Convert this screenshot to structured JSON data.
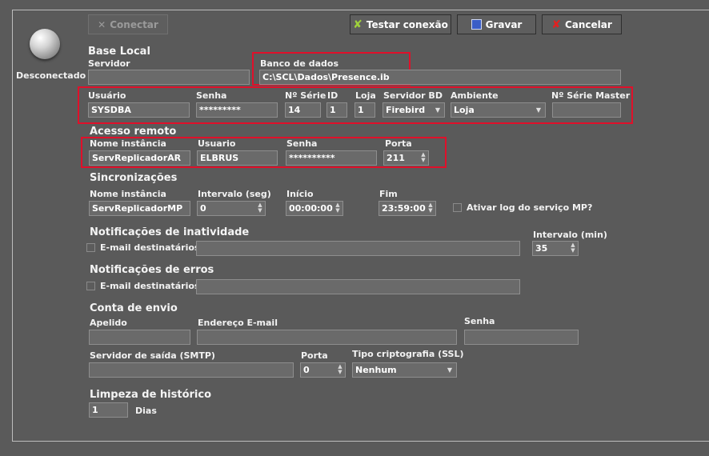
{
  "status": {
    "label": "Desconectado",
    "icon": "globe-icon"
  },
  "toolbar": {
    "connect_label": "Conectar",
    "test_label": "Testar conexão",
    "save_label": "Gravar",
    "cancel_label": "Cancelar"
  },
  "base_local": {
    "title": "Base Local",
    "servidor_label": "Servidor",
    "servidor_value": "",
    "banco_label": "Banco de dados",
    "banco_value": "C:\\SCL\\Dados\\Presence.ib",
    "usuario_label": "Usuário",
    "usuario_value": "SYSDBA",
    "senha_label": "Senha",
    "senha_value": "*********",
    "serie_label": "Nº Série",
    "serie_value": "14",
    "id_label": "ID",
    "id_value": "1",
    "loja_label": "Loja",
    "loja_value": "1",
    "servidor_bd_label": "Servidor BD",
    "servidor_bd_value": "Firebird",
    "ambiente_label": "Ambiente",
    "ambiente_value": "Loja",
    "serie_master_label": "Nº Série Master",
    "serie_master_value": ""
  },
  "acesso_remoto": {
    "title": "Acesso remoto",
    "instancia_label": "Nome instância",
    "instancia_value": "ServReplicadorAR",
    "usuario_label": "Usuario",
    "usuario_value": "ELBRUS",
    "senha_label": "Senha",
    "senha_value": "**********",
    "porta_label": "Porta",
    "porta_value": "211"
  },
  "sincronizacoes": {
    "title": "Sincronizações",
    "instancia_label": "Nome instância",
    "instancia_value": "ServReplicadorMP",
    "intervalo_label": "Intervalo (seg)",
    "intervalo_value": "0",
    "inicio_label": "Início",
    "inicio_value": "00:00:00",
    "fim_label": "Fim",
    "fim_value": "23:59:00",
    "log_label": "Ativar log do serviço MP?"
  },
  "inatividade": {
    "title": "Notificações de inatividade",
    "email_label": "E-mail destinatários",
    "email_value": "",
    "intervalo_label": "Intervalo (min)",
    "intervalo_value": "35"
  },
  "erros": {
    "title": "Notificações de erros",
    "email_label": "E-mail destinatários",
    "email_value": ""
  },
  "conta_envio": {
    "title": "Conta de envio",
    "apelido_label": "Apelido",
    "apelido_value": "",
    "endereco_label": "Endereço E-mail",
    "endereco_value": "",
    "senha_label": "Senha",
    "senha_value": "",
    "smtp_label": "Servidor de saída (SMTP)",
    "smtp_value": "",
    "porta_label": "Porta",
    "porta_value": "0",
    "cripto_label": "Tipo criptografia (SSL)",
    "cripto_value": "Nenhum"
  },
  "limpeza": {
    "title": "Limpeza de histórico",
    "value": "1",
    "unit": "Dias"
  }
}
